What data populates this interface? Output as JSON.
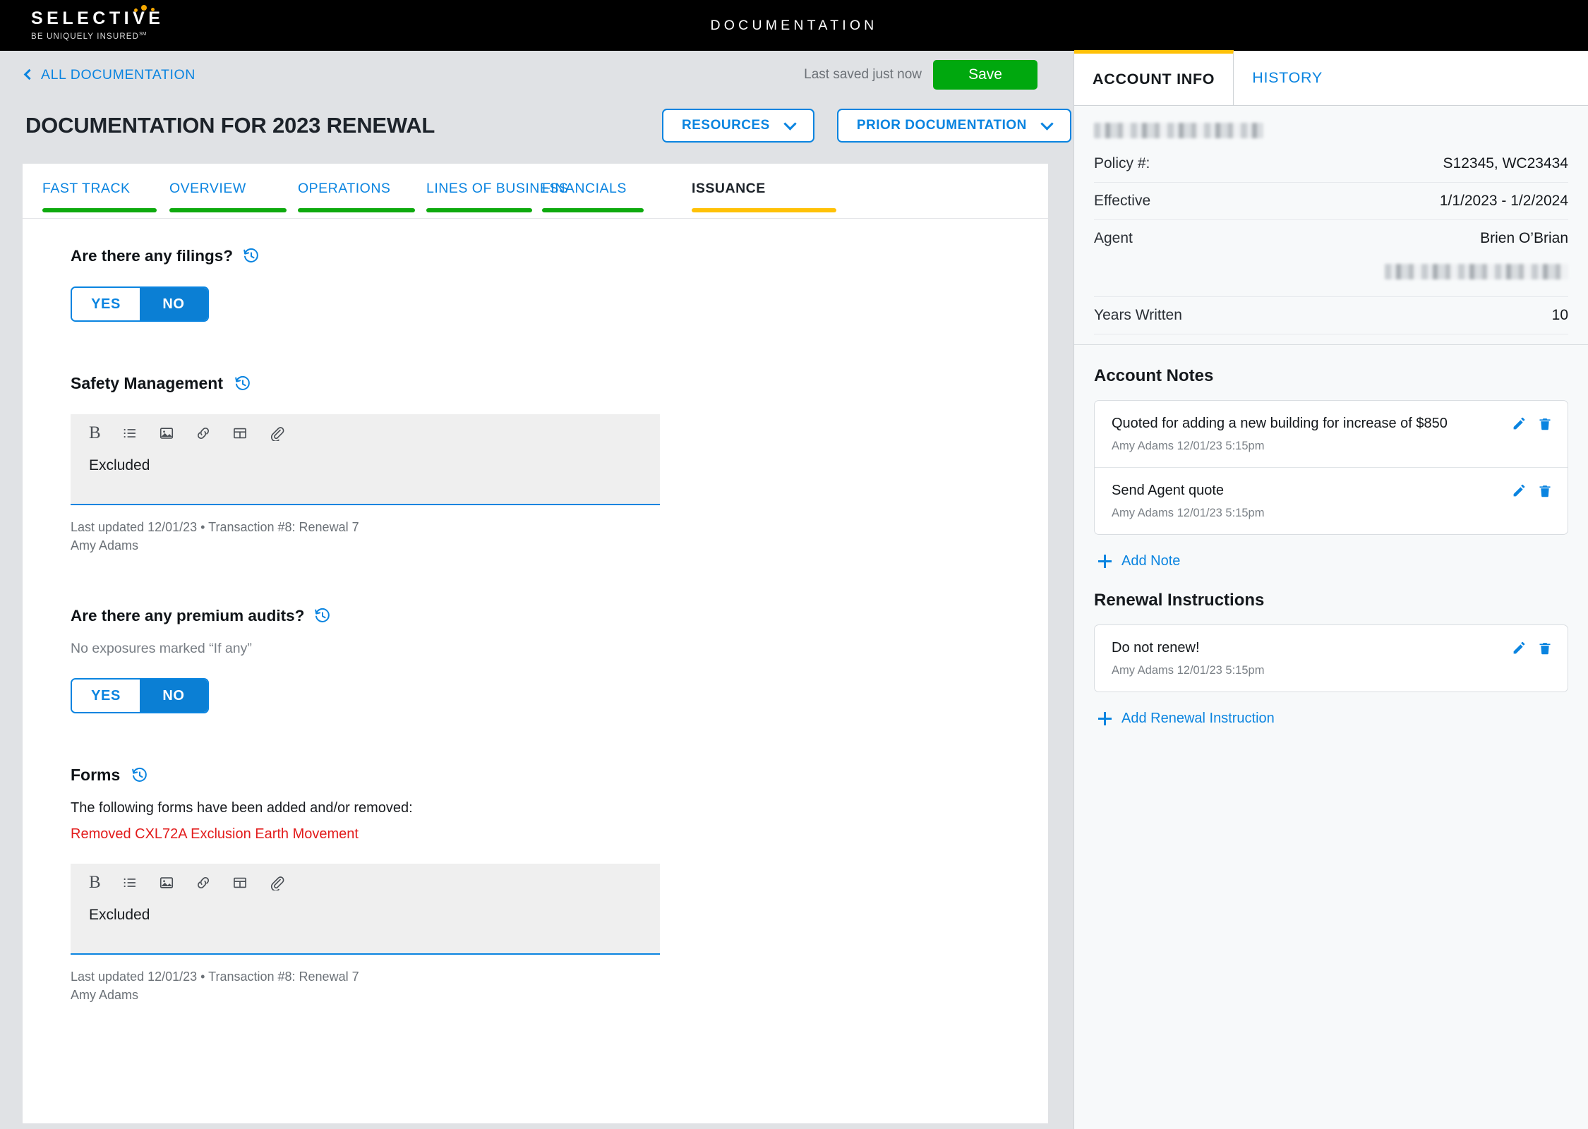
{
  "topbar": {
    "brand_name": "SELECTIVE",
    "brand_tagline": "BE UNIQUELY INSURED",
    "brand_tagline_sup": "SM",
    "title": "DOCUMENTATION"
  },
  "breadcrumb": {
    "label": "ALL DOCUMENTATION",
    "icon": "chevron-left-icon"
  },
  "save_area": {
    "status": "Last saved just now",
    "save_label": "Save",
    "save_color": "#00a80e"
  },
  "header": {
    "page_title": "DOCUMENTATION FOR 2023 RENEWAL",
    "buttons": [
      {
        "label": "RESOURCES",
        "icon": "chevron-down-icon"
      },
      {
        "label": "PRIOR DOCUMENTATION",
        "icon": "chevron-down-icon"
      }
    ]
  },
  "tabs": [
    {
      "label": "FAST TRACK",
      "state": "complete",
      "bar_color": "#0eaa0e"
    },
    {
      "label": "OVERVIEW",
      "state": "complete",
      "bar_color": "#0eaa0e"
    },
    {
      "label": "OPERATIONS",
      "state": "complete",
      "bar_color": "#0eaa0e"
    },
    {
      "label": "LINES OF BUSINESS",
      "state": "complete",
      "bar_color": "#0eaa0e"
    },
    {
      "label": "FINANCIALS",
      "state": "complete",
      "bar_color": "#0eaa0e"
    },
    {
      "label": "ISSUANCE",
      "state": "active",
      "bar_color": "#ffc107"
    }
  ],
  "main": {
    "filings": {
      "question": "Are there any filings?",
      "history_icon": "history-clock-icon",
      "toggle": {
        "yes": "YES",
        "no": "NO",
        "selected": "NO"
      }
    },
    "safety": {
      "heading": "Safety Management",
      "history_icon": "history-clock-icon",
      "toolbar": [
        "bold-icon",
        "bullet-list-icon",
        "image-icon",
        "link-icon",
        "table-icon",
        "attachment-icon"
      ],
      "content": "Excluded",
      "meta_line1": "Last updated 12/01/23 • Transaction #8: Renewal 7",
      "meta_line2": "Amy Adams"
    },
    "audits": {
      "question": "Are there any premium audits?",
      "history_icon": "history-clock-icon",
      "subtext": "No exposures marked “If any”",
      "toggle": {
        "yes": "YES",
        "no": "NO",
        "selected": "NO"
      }
    },
    "forms": {
      "heading": "Forms",
      "history_icon": "history-clock-icon",
      "description": "The following forms have been added and/or removed:",
      "removed_form": "Removed CXL72A Exclusion Earth Movement",
      "removed_color": "#e21b1b",
      "toolbar": [
        "bold-icon",
        "bullet-list-icon",
        "image-icon",
        "link-icon",
        "table-icon",
        "attachment-icon"
      ],
      "content": "Excluded",
      "meta_line1": "Last updated 12/01/23 • Transaction #8: Renewal 7",
      "meta_line2": "Amy Adams"
    }
  },
  "sidebar": {
    "tabs": [
      {
        "label": "ACCOUNT INFO",
        "active": true
      },
      {
        "label": "HISTORY",
        "active": false
      }
    ],
    "account": {
      "name_redacted": true,
      "rows": [
        {
          "key": "Policy #:",
          "value": "S12345, WC23434"
        },
        {
          "key": "Effective",
          "value": "1/1/2023 - 1/2/2024"
        },
        {
          "key": "Agent",
          "value": "Brien O’Brian",
          "value_redacted": true
        },
        {
          "key": "Years Written",
          "value": "10"
        }
      ]
    },
    "notes": {
      "title": "Account Notes",
      "items": [
        {
          "text": "Quoted for adding a new building for increase of $850",
          "meta": "Amy Adams 12/01/23 5:15pm",
          "edit_icon": "pencil-icon",
          "delete_icon": "trash-icon"
        },
        {
          "text": "Send Agent quote",
          "meta": "Amy Adams 12/01/23 5:15pm",
          "edit_icon": "pencil-icon",
          "delete_icon": "trash-icon"
        }
      ],
      "add_label": "Add Note",
      "add_icon": "plus-icon"
    },
    "renewal": {
      "title": "Renewal Instructions",
      "items": [
        {
          "text": "Do not renew!",
          "meta": "Amy Adams 12/01/23 5:15pm",
          "edit_icon": "pencil-icon",
          "delete_icon": "trash-icon"
        }
      ],
      "add_label": "Add Renewal Instruction",
      "add_icon": "plus-icon"
    }
  }
}
